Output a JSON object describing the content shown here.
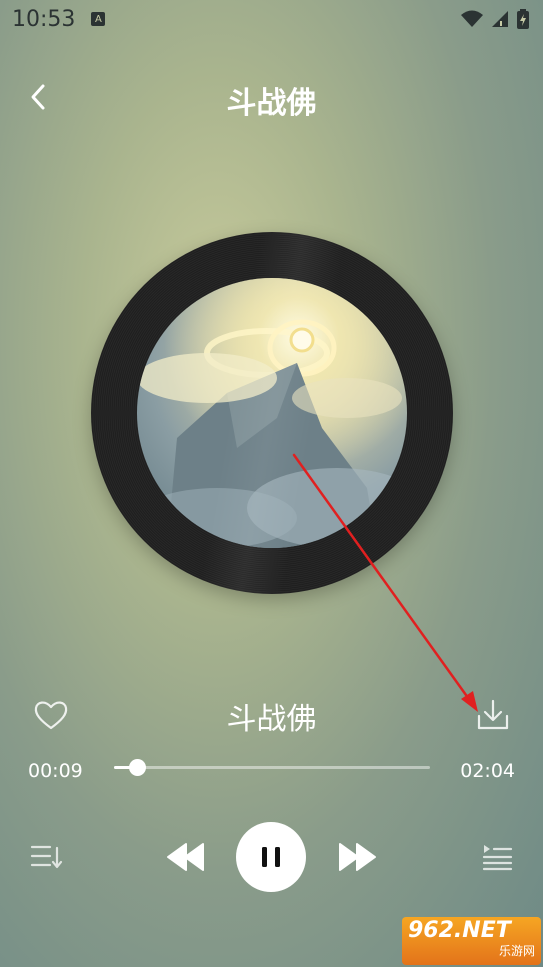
{
  "status_bar": {
    "time": "10:53",
    "notification_icon": "a-badge-icon",
    "icons": [
      "wifi-icon",
      "signal-icon",
      "battery-icon"
    ]
  },
  "header": {
    "title": "斗战佛",
    "back_icon": "chevron-left-icon"
  },
  "album": {
    "art": "mountain-clouds-halo"
  },
  "player": {
    "song_title": "斗战佛",
    "liked": false,
    "current_time": "00:09",
    "total_time": "02:04",
    "progress": 0.073
  },
  "controls": {
    "playlist_icon": "playlist-icon",
    "prev_icon": "rewind-icon",
    "play_state": "playing",
    "pause_icon": "pause-icon",
    "next_icon": "fast-forward-icon",
    "queue_icon": "queue-icon"
  },
  "colors": {
    "accent": "#ffffff",
    "annotation_arrow": "#e02020",
    "watermark": "#f29a21"
  },
  "watermark": {
    "main": "962.NET",
    "sub": "乐游网"
  }
}
